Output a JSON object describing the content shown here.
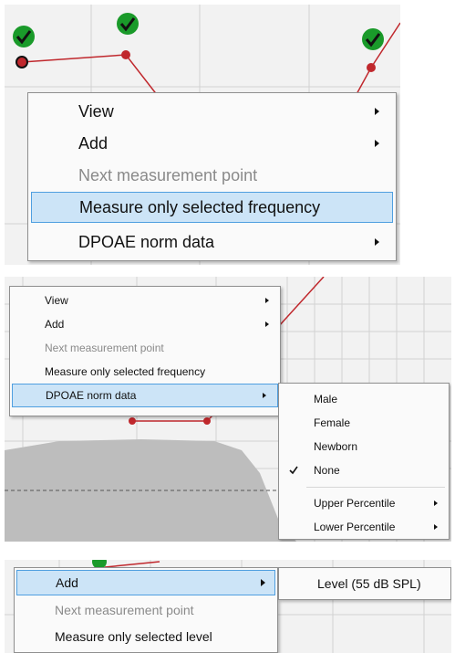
{
  "panel1": {
    "menu": [
      {
        "label": "View",
        "submenu": true,
        "enabled": true,
        "highlighted": false
      },
      {
        "label": "Add",
        "submenu": true,
        "enabled": true,
        "highlighted": false
      },
      {
        "label": "Next measurement point",
        "submenu": false,
        "enabled": false,
        "highlighted": false
      },
      {
        "label": "Measure only selected  frequency",
        "submenu": false,
        "enabled": true,
        "highlighted": true
      },
      {
        "label": "DPOAE norm data",
        "submenu": true,
        "enabled": true,
        "highlighted": false
      }
    ]
  },
  "panel2": {
    "menu": [
      {
        "label": "View",
        "submenu": true,
        "enabled": true,
        "highlighted": false
      },
      {
        "label": "Add",
        "submenu": true,
        "enabled": true,
        "highlighted": false
      },
      {
        "label": "Next measurement point",
        "submenu": false,
        "enabled": false,
        "highlighted": false
      },
      {
        "label": "Measure only selected  frequency",
        "submenu": false,
        "enabled": true,
        "highlighted": false
      },
      {
        "label": "DPOAE norm data",
        "submenu": true,
        "enabled": true,
        "highlighted": true
      }
    ],
    "submenu": [
      {
        "label": "Male",
        "checked": false,
        "submenu": false
      },
      {
        "label": "Female",
        "checked": false,
        "submenu": false
      },
      {
        "label": "Newborn",
        "checked": false,
        "submenu": false
      },
      {
        "label": "None",
        "checked": true,
        "submenu": false
      },
      {
        "label": "Upper Percentile",
        "checked": false,
        "submenu": true
      },
      {
        "label": "Lower Percentile",
        "checked": false,
        "submenu": true
      }
    ]
  },
  "panel3": {
    "menu": [
      {
        "label": "Add",
        "submenu": true,
        "enabled": true,
        "highlighted": true
      },
      {
        "label": "Next measurement point",
        "submenu": false,
        "enabled": false,
        "highlighted": false
      },
      {
        "label": "Measure only selected  level",
        "submenu": false,
        "enabled": true,
        "highlighted": false
      }
    ],
    "submenu": [
      {
        "label": "Level (55 dB SPL)",
        "submenu": false
      }
    ]
  },
  "colors": {
    "highlight": "#cce4f7",
    "highlight_border": "#4f9fe0",
    "curve_red": "#c0282d",
    "check_green": "#1a9a2a",
    "disabled_text": "#8a8a8a"
  }
}
